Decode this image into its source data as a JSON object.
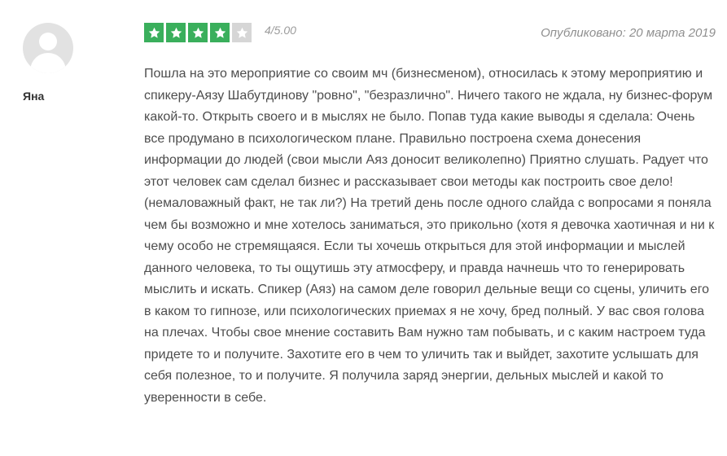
{
  "author": {
    "name": "Яна",
    "avatar_icon": "user-silhouette-icon"
  },
  "rating": {
    "value": 4,
    "max": 5,
    "score_text": "4/5.00",
    "filled_color": "#3aaf5c",
    "empty_color": "#d6d6d6"
  },
  "published": "Опубликовано: 20 марта 2019",
  "review_text": "Пошла на это мероприятие со своим мч (бизнесменом), относилась к этому мероприятию и спикеру-Аязу Шабутдинову \"ровно\", \"безразлично\". Ничего такого не ждала, ну бизнес-форум какой-то. Открыть своего и в мыслях не было. Попав туда какие выводы я сделала: Очень все продумано в психологическом плане. Правильно построена схема донесения информации до людей (свои мысли Аяз доносит великолепно) Приятно слушать. Радует что этот человек сам сделал бизнес и рассказывает свои методы как построить свое дело! (немаловажный факт, не так ли?) На третий день после одного слайда с вопросами я поняла чем бы возможно и мне хотелось заниматься, это прикольно (хотя я девочка хаотичная и ни к чему особо не стремящаяся. Если ты хочешь открыться для этой информации и мыслей данного человека, то ты ощутишь эту атмосферу, и правда начнешь что то генерировать мыслить и искать. Спикер (Аяз) на самом деле говорил дельные вещи со сцены, уличить его в каком то гипнозе, или психологических приемах я не хочу, бред полный. У вас своя голова на плечах. Чтобы свое мнение составить Вам нужно там побывать, и с каким настроем туда придете то и получите. Захотите его в чем то уличить так и выйдет, захотите услышать для себя полезное, то и получите. Я получила заряд энергии, дельных мыслей и какой то уверенности в себе."
}
